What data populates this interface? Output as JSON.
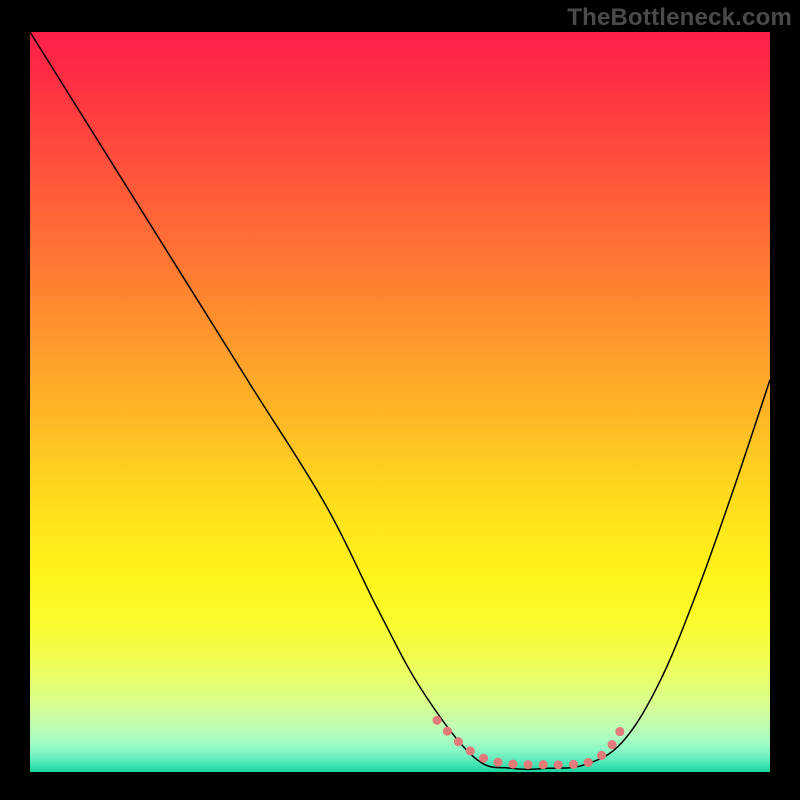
{
  "watermark": "TheBottleneck.com",
  "chart_data": {
    "type": "line",
    "title": "",
    "xlabel": "",
    "ylabel": "",
    "xlim": [
      0,
      100
    ],
    "ylim": [
      0,
      100
    ],
    "grid": false,
    "legend": false,
    "series": [
      {
        "name": "bottleneck-curve",
        "x": [
          0,
          10,
          20,
          30,
          40,
          47,
          53,
          60,
          65,
          70,
          75,
          80,
          85,
          90,
          95,
          100
        ],
        "values": [
          100,
          84,
          68,
          52,
          36,
          22,
          11,
          2,
          0.5,
          0.5,
          1,
          4,
          12,
          24,
          38,
          53
        ]
      }
    ],
    "annotations": [
      {
        "name": "trough-dots",
        "x": [
          55,
          58,
          61,
          64,
          67,
          70,
          73,
          76,
          78.5,
          80.5
        ],
        "values": [
          7,
          4,
          2,
          1.2,
          1,
          1,
          1,
          1.5,
          3.5,
          7
        ]
      }
    ],
    "background_gradient": {
      "orientation": "vertical",
      "stops": [
        {
          "pos": 0.0,
          "color": "#ff1f4a"
        },
        {
          "pos": 0.4,
          "color": "#ff9a2c"
        },
        {
          "pos": 0.7,
          "color": "#fff318"
        },
        {
          "pos": 0.92,
          "color": "#d0fe9a"
        },
        {
          "pos": 1.0,
          "color": "#18d79e"
        }
      ]
    }
  }
}
